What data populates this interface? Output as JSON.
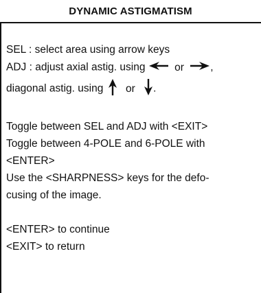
{
  "title": "DYNAMIC ASTIGMATISM",
  "lines": {
    "sel": "SEL : select area using arrow keys",
    "adj_prefix": "ADJ : adjust axial astig. using",
    "adj_or": "or",
    "adj_suffix": ",",
    "diag_prefix": "diagonal astig. using",
    "diag_or": "or",
    "diag_suffix": ".",
    "toggle_sel_adj": "Toggle between SEL and ADJ with <EXIT>",
    "toggle_pole_1": "Toggle between 4-POLE and 6-POLE with",
    "toggle_pole_2": "<ENTER>",
    "sharpness_1": "Use the <SHARPNESS> keys for the defo-",
    "sharpness_2": "cusing of the image.",
    "enter_continue": "<ENTER> to continue",
    "exit_return": "<EXIT> to return"
  },
  "icons": {
    "left": "arrow-left-icon",
    "right": "arrow-right-icon",
    "up": "arrow-up-icon",
    "down": "arrow-down-icon"
  }
}
